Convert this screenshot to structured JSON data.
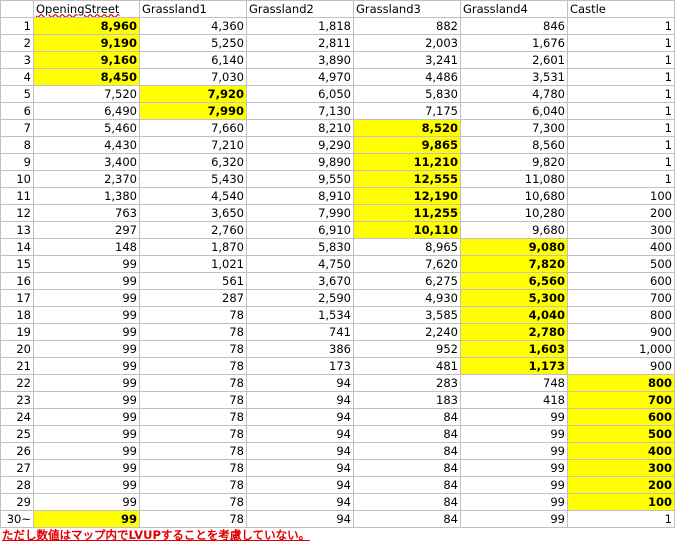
{
  "columns": [
    "",
    "OpeningStreet",
    "Grassland1",
    "Grassland2",
    "Grassland3",
    "Grassland4",
    "Castle"
  ],
  "highlight_color": "#ffff00",
  "note_color": "#e00000",
  "rows": [
    {
      "label": "1",
      "values": [
        "8,960",
        "4,360",
        "1,818",
        "882",
        "846",
        "1"
      ],
      "highlight": [
        true,
        false,
        false,
        false,
        false,
        false
      ]
    },
    {
      "label": "2",
      "values": [
        "9,190",
        "5,250",
        "2,811",
        "2,003",
        "1,676",
        "1"
      ],
      "highlight": [
        true,
        false,
        false,
        false,
        false,
        false
      ]
    },
    {
      "label": "3",
      "values": [
        "9,160",
        "6,140",
        "3,890",
        "3,241",
        "2,601",
        "1"
      ],
      "highlight": [
        true,
        false,
        false,
        false,
        false,
        false
      ]
    },
    {
      "label": "4",
      "values": [
        "8,450",
        "7,030",
        "4,970",
        "4,486",
        "3,531",
        "1"
      ],
      "highlight": [
        true,
        false,
        false,
        false,
        false,
        false
      ]
    },
    {
      "label": "5",
      "values": [
        "7,520",
        "7,920",
        "6,050",
        "5,830",
        "4,780",
        "1"
      ],
      "highlight": [
        false,
        true,
        false,
        false,
        false,
        false
      ]
    },
    {
      "label": "6",
      "values": [
        "6,490",
        "7,990",
        "7,130",
        "7,175",
        "6,040",
        "1"
      ],
      "highlight": [
        false,
        true,
        false,
        false,
        false,
        false
      ]
    },
    {
      "label": "7",
      "values": [
        "5,460",
        "7,660",
        "8,210",
        "8,520",
        "7,300",
        "1"
      ],
      "highlight": [
        false,
        false,
        false,
        true,
        false,
        false
      ]
    },
    {
      "label": "8",
      "values": [
        "4,430",
        "7,210",
        "9,290",
        "9,865",
        "8,560",
        "1"
      ],
      "highlight": [
        false,
        false,
        false,
        true,
        false,
        false
      ]
    },
    {
      "label": "9",
      "values": [
        "3,400",
        "6,320",
        "9,890",
        "11,210",
        "9,820",
        "1"
      ],
      "highlight": [
        false,
        false,
        false,
        true,
        false,
        false
      ]
    },
    {
      "label": "10",
      "values": [
        "2,370",
        "5,430",
        "9,550",
        "12,555",
        "11,080",
        "1"
      ],
      "highlight": [
        false,
        false,
        false,
        true,
        false,
        false
      ]
    },
    {
      "label": "11",
      "values": [
        "1,380",
        "4,540",
        "8,910",
        "12,190",
        "10,680",
        "100"
      ],
      "highlight": [
        false,
        false,
        false,
        true,
        false,
        false
      ]
    },
    {
      "label": "12",
      "values": [
        "763",
        "3,650",
        "7,990",
        "11,255",
        "10,280",
        "200"
      ],
      "highlight": [
        false,
        false,
        false,
        true,
        false,
        false
      ]
    },
    {
      "label": "13",
      "values": [
        "297",
        "2,760",
        "6,910",
        "10,110",
        "9,680",
        "300"
      ],
      "highlight": [
        false,
        false,
        false,
        true,
        false,
        false
      ]
    },
    {
      "label": "14",
      "values": [
        "148",
        "1,870",
        "5,830",
        "8,965",
        "9,080",
        "400"
      ],
      "highlight": [
        false,
        false,
        false,
        false,
        true,
        false
      ]
    },
    {
      "label": "15",
      "values": [
        "99",
        "1,021",
        "4,750",
        "7,620",
        "7,820",
        "500"
      ],
      "highlight": [
        false,
        false,
        false,
        false,
        true,
        false
      ]
    },
    {
      "label": "16",
      "values": [
        "99",
        "561",
        "3,670",
        "6,275",
        "6,560",
        "600"
      ],
      "highlight": [
        false,
        false,
        false,
        false,
        true,
        false
      ]
    },
    {
      "label": "17",
      "values": [
        "99",
        "287",
        "2,590",
        "4,930",
        "5,300",
        "700"
      ],
      "highlight": [
        false,
        false,
        false,
        false,
        true,
        false
      ]
    },
    {
      "label": "18",
      "values": [
        "99",
        "78",
        "1,534",
        "3,585",
        "4,040",
        "800"
      ],
      "highlight": [
        false,
        false,
        false,
        false,
        true,
        false
      ]
    },
    {
      "label": "19",
      "values": [
        "99",
        "78",
        "741",
        "2,240",
        "2,780",
        "900"
      ],
      "highlight": [
        false,
        false,
        false,
        false,
        true,
        false
      ]
    },
    {
      "label": "20",
      "values": [
        "99",
        "78",
        "386",
        "952",
        "1,603",
        "1,000"
      ],
      "highlight": [
        false,
        false,
        false,
        false,
        true,
        false
      ]
    },
    {
      "label": "21",
      "values": [
        "99",
        "78",
        "173",
        "481",
        "1,173",
        "900"
      ],
      "highlight": [
        false,
        false,
        false,
        false,
        true,
        false
      ]
    },
    {
      "label": "22",
      "values": [
        "99",
        "78",
        "94",
        "283",
        "748",
        "800"
      ],
      "highlight": [
        false,
        false,
        false,
        false,
        false,
        true
      ]
    },
    {
      "label": "23",
      "values": [
        "99",
        "78",
        "94",
        "183",
        "418",
        "700"
      ],
      "highlight": [
        false,
        false,
        false,
        false,
        false,
        true
      ]
    },
    {
      "label": "24",
      "values": [
        "99",
        "78",
        "94",
        "84",
        "99",
        "600"
      ],
      "highlight": [
        false,
        false,
        false,
        false,
        false,
        true
      ]
    },
    {
      "label": "25",
      "values": [
        "99",
        "78",
        "94",
        "84",
        "99",
        "500"
      ],
      "highlight": [
        false,
        false,
        false,
        false,
        false,
        true
      ]
    },
    {
      "label": "26",
      "values": [
        "99",
        "78",
        "94",
        "84",
        "99",
        "400"
      ],
      "highlight": [
        false,
        false,
        false,
        false,
        false,
        true
      ]
    },
    {
      "label": "27",
      "values": [
        "99",
        "78",
        "94",
        "84",
        "99",
        "300"
      ],
      "highlight": [
        false,
        false,
        false,
        false,
        false,
        true
      ]
    },
    {
      "label": "28",
      "values": [
        "99",
        "78",
        "94",
        "84",
        "99",
        "200"
      ],
      "highlight": [
        false,
        false,
        false,
        false,
        false,
        true
      ]
    },
    {
      "label": "29",
      "values": [
        "99",
        "78",
        "94",
        "84",
        "99",
        "100"
      ],
      "highlight": [
        false,
        false,
        false,
        false,
        false,
        true
      ]
    },
    {
      "label": "30~",
      "values": [
        "99",
        "78",
        "94",
        "84",
        "99",
        "1"
      ],
      "highlight": [
        true,
        false,
        false,
        false,
        false,
        false
      ]
    }
  ],
  "note": "ただし数値はマップ内でLVUPすることを考慮していない。"
}
